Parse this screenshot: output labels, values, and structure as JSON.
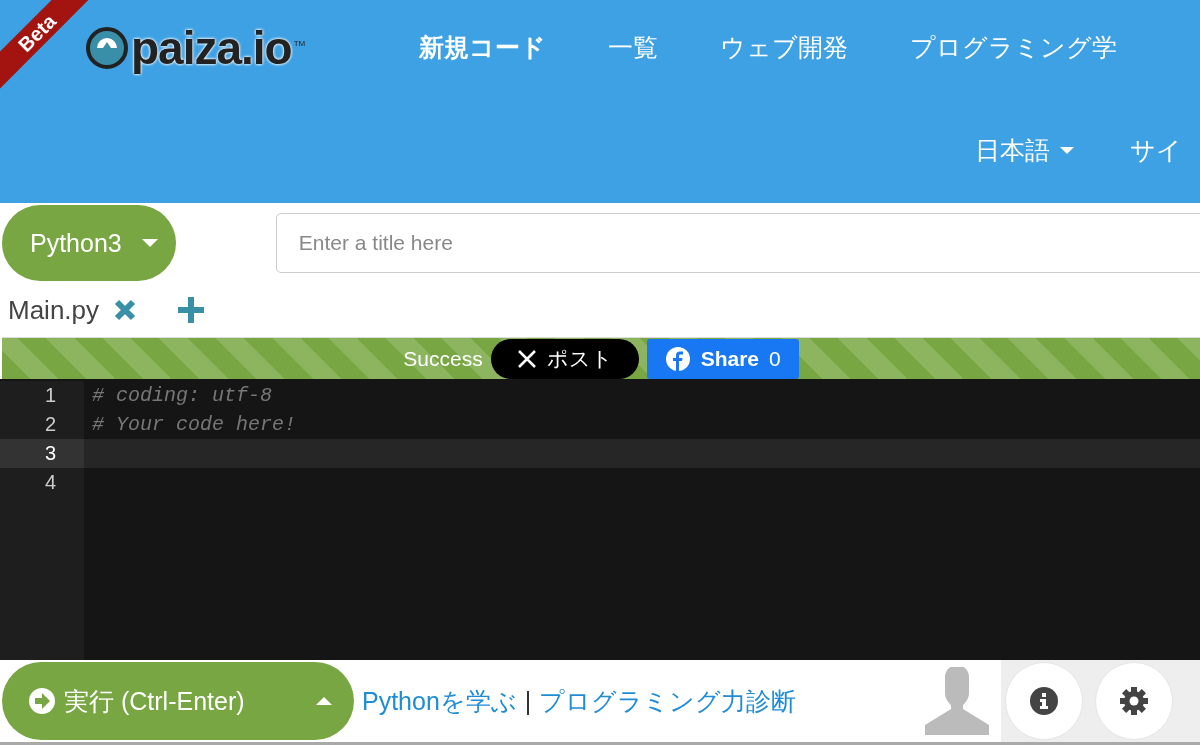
{
  "header": {
    "ribbon": "Beta",
    "logo": "paiza.io",
    "logo_mark": "TM",
    "nav": [
      {
        "label": "新規コード",
        "selected": true
      },
      {
        "label": "一覧",
        "selected": false
      },
      {
        "label": "ウェブ開発",
        "selected": false
      },
      {
        "label": "プログラミング学",
        "selected": false
      }
    ],
    "language_menu": "日本語",
    "signin": "サイ"
  },
  "toolbar": {
    "language": "Python3",
    "title_field": {
      "placeholder": "Enter a title here"
    }
  },
  "file_tabs": [
    {
      "label": "Main.py"
    }
  ],
  "status": {
    "text": "Success",
    "post_button": "ポスト",
    "share_button": "Share",
    "share_count": "0"
  },
  "editor": {
    "lines": [
      {
        "number": "1",
        "code": "# coding: utf-8",
        "active": false
      },
      {
        "number": "2",
        "code": "# Your code here!",
        "active": false
      },
      {
        "number": "3",
        "active": true
      },
      {
        "number": "4",
        "active": false
      }
    ]
  },
  "footer": {
    "run_button": "実行 (Ctrl-Enter)",
    "links": [
      "Pythonを学ぶ",
      "プログラミング力診断"
    ],
    "separator": "|"
  }
}
